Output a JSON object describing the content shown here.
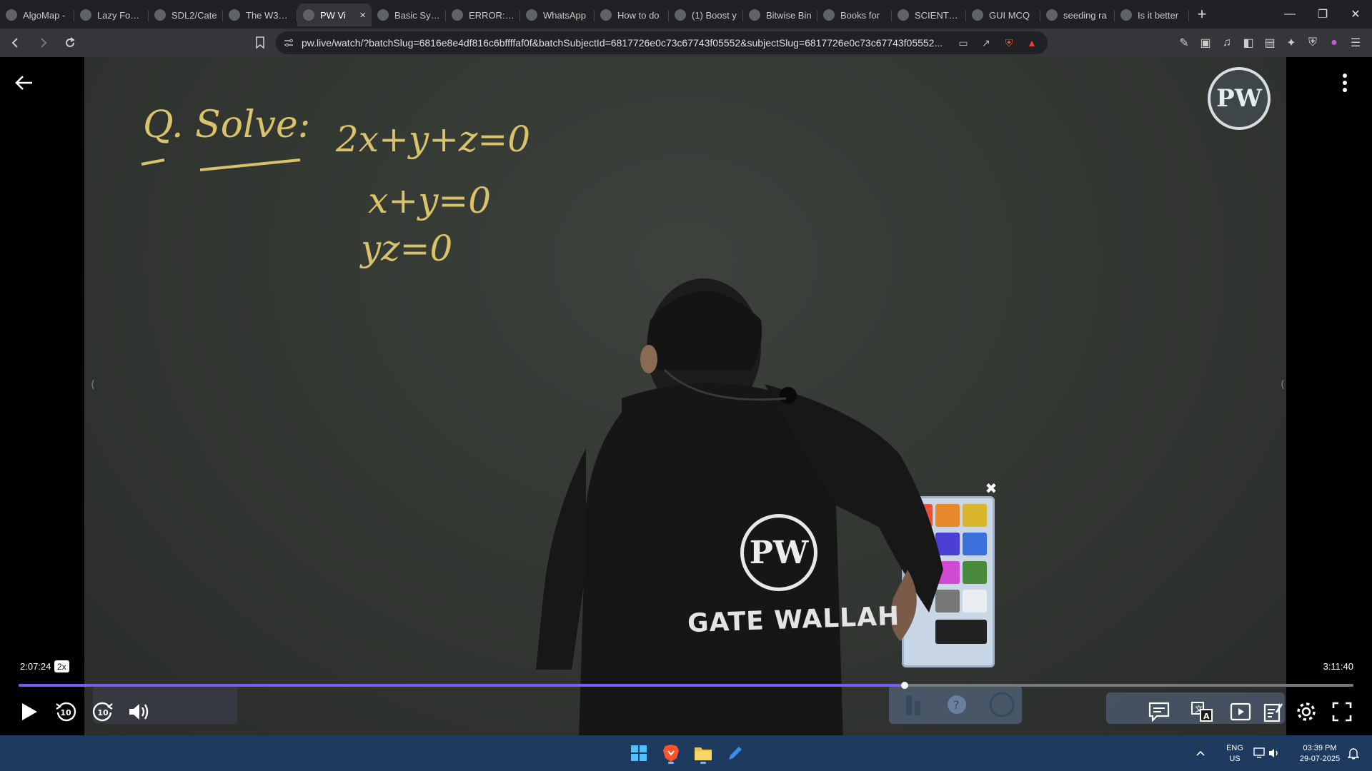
{
  "browser": {
    "tabs": [
      {
        "label": "AlgoMap -",
        "icon": "algomap-favicon"
      },
      {
        "label": "Lazy Foo' P",
        "icon": "lazyfoo-favicon"
      },
      {
        "label": "SDL2/Cate",
        "icon": "sdl-favicon"
      },
      {
        "label": "The W3C M",
        "icon": "w3c-favicon"
      },
      {
        "label": "PW Vi",
        "icon": "pw-favicon",
        "active": true
      },
      {
        "label": "Basic Synta",
        "icon": "doc-favicon"
      },
      {
        "label": "ERROR: Th",
        "icon": "error-favicon"
      },
      {
        "label": "WhatsApp",
        "icon": "whatsapp-favicon"
      },
      {
        "label": "How to do",
        "icon": "chat-favicon"
      },
      {
        "label": "(1) Boost y",
        "icon": "youtube-favicon"
      },
      {
        "label": "Bitwise Bin",
        "icon": "bitwise-favicon"
      },
      {
        "label": "Books for",
        "icon": "google-favicon"
      },
      {
        "label": "SCIENTIFIC",
        "icon": "scientific-favicon"
      },
      {
        "label": "GUI MCQ",
        "icon": "gear-favicon"
      },
      {
        "label": "seeding ra",
        "icon": "google-favicon"
      },
      {
        "label": "Is it better",
        "icon": "google-favicon"
      }
    ],
    "new_tab_label": "+",
    "url": "pw.live/watch/?batchSlug=6816e8e4df816c6bffffaf0f&batchSubjectId=6817726e0c73c67743f05552&subjectSlug=6817726e0c73c67743f05552..."
  },
  "player": {
    "current_time": "2:07:24",
    "speed": "2x",
    "total_time": "3:11:40",
    "progress_fraction": 0.664,
    "skip_seconds": "10"
  },
  "board": {
    "watermark_text": "PW",
    "lines": [
      "Q. Solve:",
      "2x+y+z=0",
      "x+y=0",
      "yz=0"
    ]
  },
  "teacher_shirt": {
    "logo_text": "PW",
    "text": "GATE WALLAH"
  },
  "taskbar": {
    "lang_top": "ENG",
    "lang_bottom": "US",
    "time": "03:39 PM",
    "date": "29-07-2025"
  },
  "colors": {
    "accent_progress": "#7b5cf0",
    "board": "#363a35",
    "chalk": "#d9c36a",
    "taskbar": "#1e3a5f"
  }
}
